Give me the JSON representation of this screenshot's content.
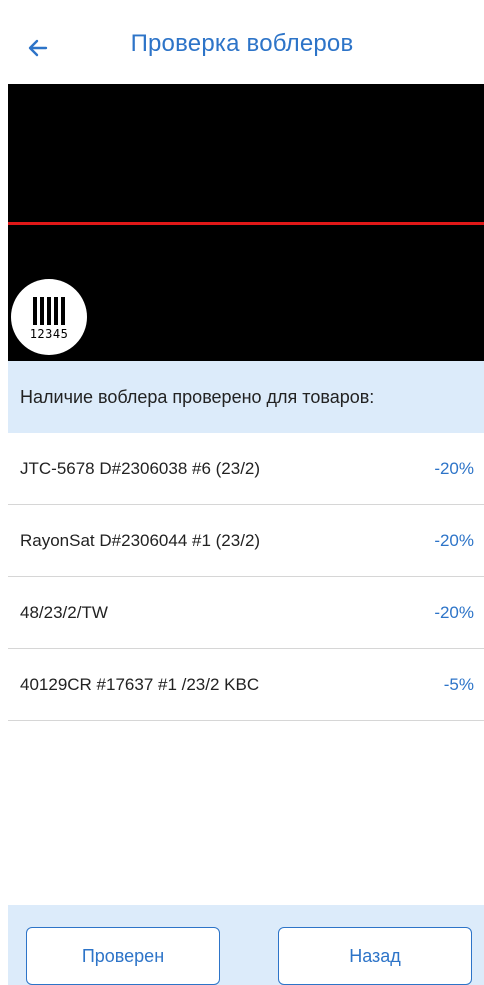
{
  "header": {
    "title": "Проверка воблеров",
    "back_icon": "arrow-left-icon"
  },
  "scanner": {
    "barcode_icon": "barcode-icon",
    "barcode_number": "12345",
    "scan_line_color": "#e01818"
  },
  "section": {
    "title": "Наличие воблера проверено для товаров:"
  },
  "items": [
    {
      "name": "JTC-5678 D#2306038 #6 (23/2)",
      "discount": "-20%"
    },
    {
      "name": "RayonSat D#2306044 #1 (23/2)",
      "discount": "-20%"
    },
    {
      "name": "48/23/2/TW",
      "discount": "-20%"
    },
    {
      "name": "40129CR #17637 #1 /23/2 KBC",
      "discount": "-5%"
    }
  ],
  "footer": {
    "checked_label": "Проверен",
    "back_label": "Назад"
  },
  "colors": {
    "accent": "#2d74c8",
    "section_bg": "#dcebfa"
  }
}
